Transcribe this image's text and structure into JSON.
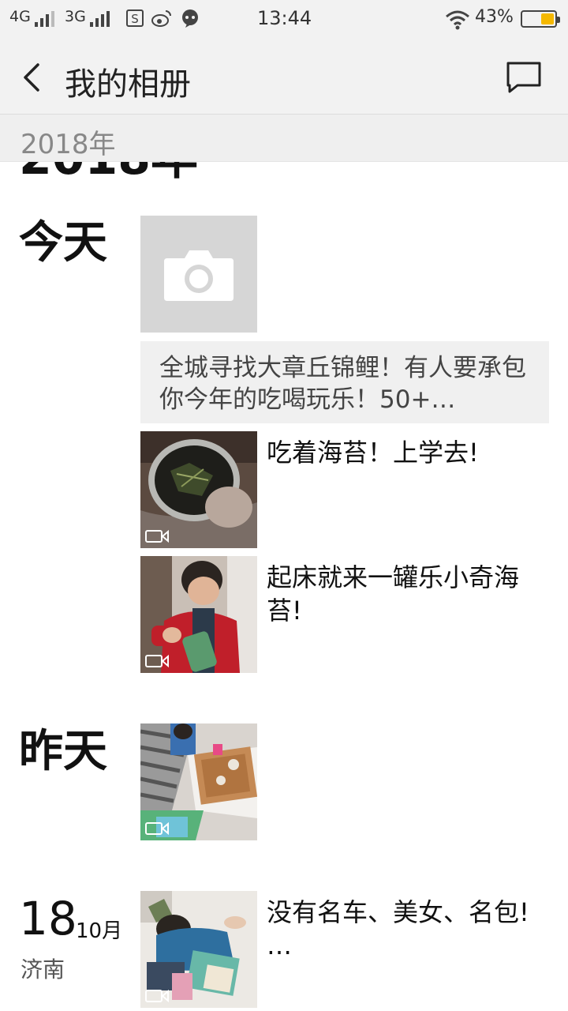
{
  "status_bar": {
    "network1": "4G",
    "network2": "3G",
    "time": "13:44",
    "battery_percent": "43%",
    "icons": [
      "signal-icon",
      "s-app-icon",
      "weibo-icon",
      "chat-app-icon",
      "wifi-icon",
      "battery-icon"
    ]
  },
  "header": {
    "title": "我的相册",
    "back_icon": "chevron-left-icon",
    "message_icon": "message-bubble-icon"
  },
  "sticky_year": "2018年",
  "timeline": {
    "year_heading": "2018年",
    "today": {
      "label": "今天",
      "camera_icon": "camera-icon",
      "share_text": "全城寻找大章丘锦鲤！有人要承包你今年的吃喝玩乐！50+…",
      "posts": [
        {
          "text": "吃着海苔！上学去!",
          "media": "video"
        },
        {
          "text": "起床就来一罐乐小奇海苔!",
          "media": "video"
        }
      ]
    },
    "yesterday": {
      "label": "昨天",
      "posts": [
        {
          "text": "",
          "media": "video"
        }
      ]
    },
    "dated": {
      "day": "18",
      "month": "10月",
      "location": "济南",
      "posts": [
        {
          "text": "没有名车、美女、名包! …",
          "media": "video"
        }
      ]
    }
  }
}
